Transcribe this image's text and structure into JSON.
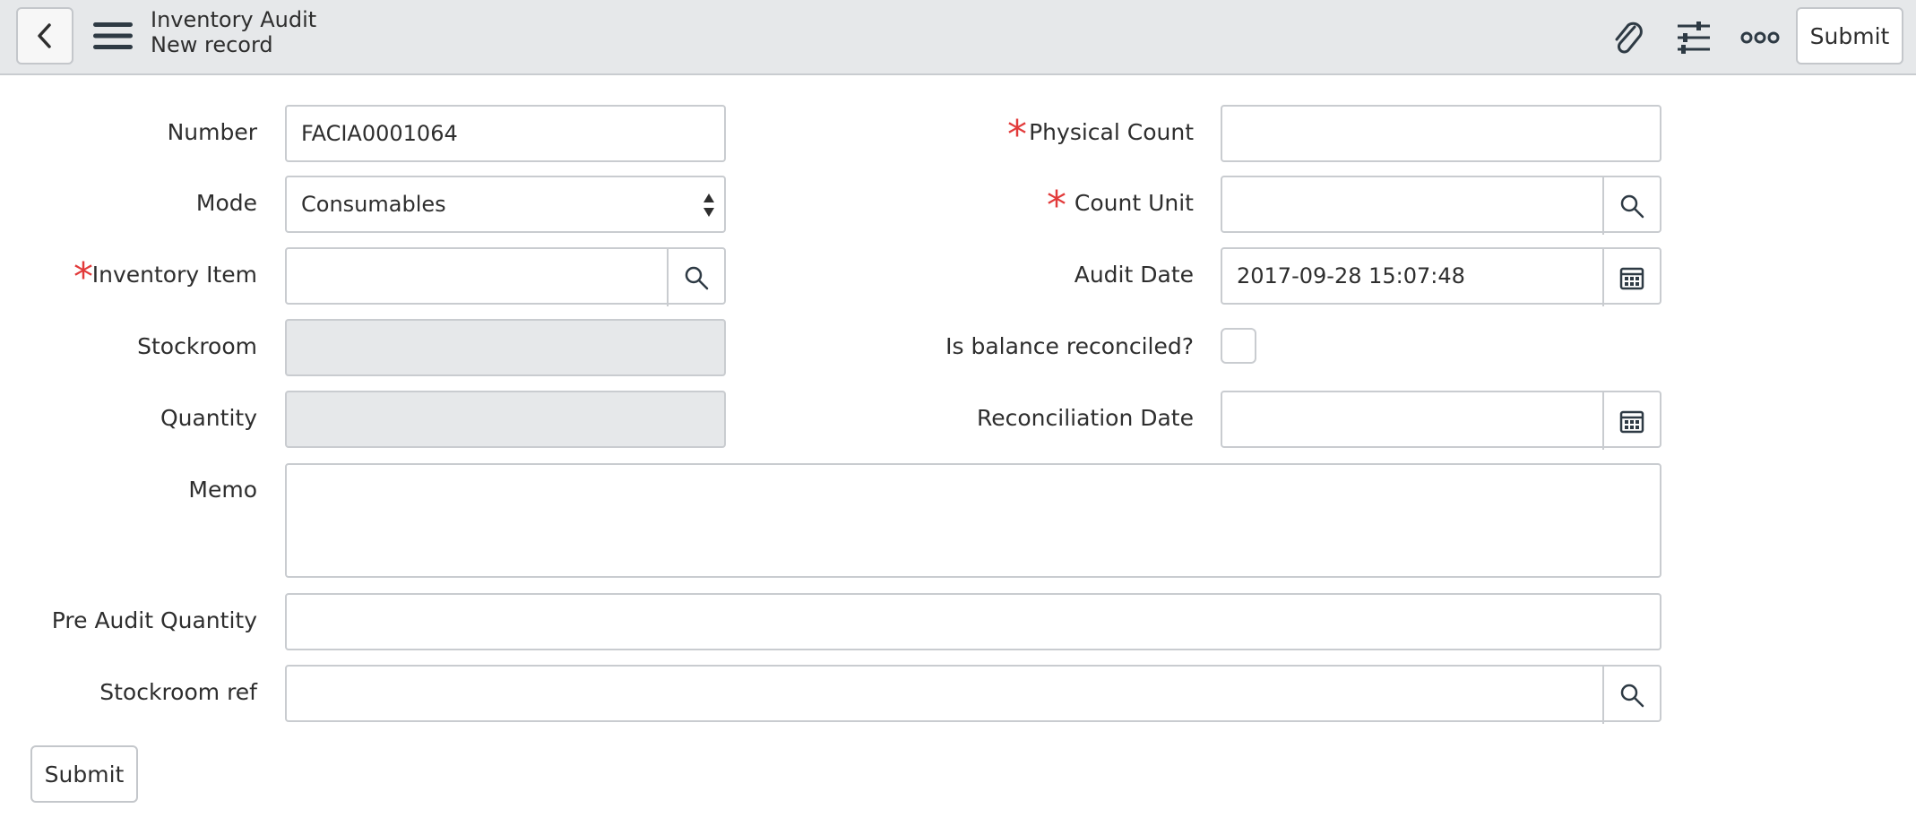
{
  "header": {
    "title": "Inventory Audit",
    "subtitle": "New record",
    "submit_label": "Submit",
    "icons": [
      "chevron-left-icon",
      "hamburger-menu-icon",
      "paperclip-icon",
      "sliders-icon",
      "more-options-icon"
    ]
  },
  "form": {
    "number": {
      "label": "Number",
      "value": "FACIA0001064"
    },
    "mode": {
      "label": "Mode",
      "value": "Consumables"
    },
    "inventory_item": {
      "label": "Inventory Item",
      "value": ""
    },
    "stockroom": {
      "label": "Stockroom",
      "value": ""
    },
    "quantity": {
      "label": "Quantity",
      "value": ""
    },
    "physical_count": {
      "label": "Physical Count",
      "value": ""
    },
    "count_unit": {
      "label": "Count Unit",
      "value": ""
    },
    "audit_date": {
      "label": "Audit Date",
      "value": "2017-09-28 15:07:48"
    },
    "is_balance_reconciled": {
      "label": "Is balance reconciled?",
      "checked": false
    },
    "reconciliation_date": {
      "label": "Reconciliation Date",
      "value": ""
    },
    "memo": {
      "label": "Memo",
      "value": ""
    },
    "pre_audit_quantity": {
      "label": "Pre Audit Quantity",
      "value": ""
    },
    "stockroom_ref": {
      "label": "Stockroom ref",
      "value": ""
    }
  },
  "footer": {
    "submit_label": "Submit"
  },
  "colors": {
    "required": "#e23a3a",
    "header_bg": "#e6e8ea",
    "readonly_bg": "#e6e8ea",
    "border": "#c9ccd0"
  }
}
